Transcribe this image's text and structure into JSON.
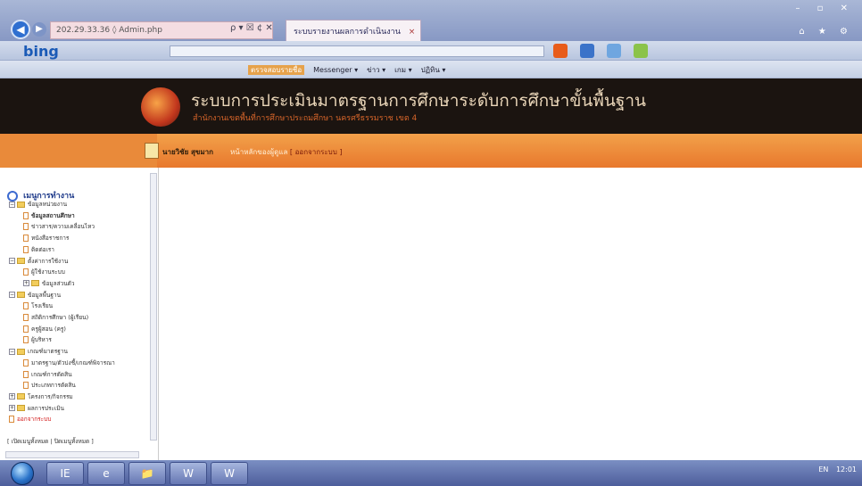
{
  "browser": {
    "address_text": "202.29.33.36 ◊ Admin.php",
    "address_controls": "ρ ▾ ☒ ¢ ✕",
    "tab_title": "ระบบรายงานผลการดำเนินงาน",
    "tab_close": "×",
    "window_controls": "– ▫ ✕",
    "window_controls_2": "⌂ ★ ⚙"
  },
  "bing_bar": {
    "logo": "bing",
    "icon_colors": [
      "#e85c1a",
      "#3b73c9",
      "#6fa6e0",
      "#8bc34a"
    ]
  },
  "favorites_bar": {
    "items": [
      "ตรวจสอบรายชื่อ",
      "Messenger ▾",
      "ข่าว ▾",
      "เกม ▾",
      "ปฏิทิน ▾"
    ]
  },
  "site": {
    "title": "ระบบการประเมินมาตรฐานการศึกษาระดับการศึกษาขั้นพื้นฐาน",
    "subtitle": "สำนักงานเขตพื้นที่การศึกษาประถมศึกษา นครศรีธรรมราช เขต 4"
  },
  "user_bar": {
    "user_name": "นายวิชัย สุขมาก",
    "status_text": "หน้าหลักของผู้ดูแล",
    "logout_label": "[ ออกจากระบบ ]"
  },
  "left_menu": {
    "title": "เมนูการทำงาน",
    "items": [
      {
        "type": "folder",
        "level": 0,
        "label": "ข้อมูลหน่วยงาน",
        "toggle": "−"
      },
      {
        "type": "doc",
        "level": 1,
        "label": "ข้อมูลสถานศึกษา",
        "bold": true
      },
      {
        "type": "doc",
        "level": 1,
        "label": "ข่าวสาร/ความเคลื่อนไหว"
      },
      {
        "type": "doc",
        "level": 1,
        "label": "หนังสือราชการ"
      },
      {
        "type": "doc",
        "level": 1,
        "label": "ติดต่อเรา"
      },
      {
        "type": "folder",
        "level": 0,
        "label": "ตั้งค่าการใช้งาน",
        "toggle": "−"
      },
      {
        "type": "doc",
        "level": 1,
        "label": "ผู้ใช้งานระบบ"
      },
      {
        "type": "folder",
        "level": 1,
        "label": "ข้อมูลส่วนตัว",
        "toggle": "+"
      },
      {
        "type": "folder",
        "level": 0,
        "label": "ข้อมูลพื้นฐาน",
        "toggle": "−"
      },
      {
        "type": "doc",
        "level": 1,
        "label": "โรงเรียน"
      },
      {
        "type": "doc",
        "level": 1,
        "label": "สถิติการศึกษา (ผู้เรียน)"
      },
      {
        "type": "doc",
        "level": 1,
        "label": "ครูผู้สอน (ครู)"
      },
      {
        "type": "doc",
        "level": 1,
        "label": "ผู้บริหาร"
      },
      {
        "type": "folder",
        "level": 0,
        "label": "เกณฑ์มาตรฐาน",
        "toggle": "−"
      },
      {
        "type": "doc",
        "level": 1,
        "label": "มาตรฐาน/ตัวบ่งชี้/เกณฑ์พิจารณา"
      },
      {
        "type": "doc",
        "level": 1,
        "label": "เกณฑ์การตัดสิน"
      },
      {
        "type": "doc",
        "level": 1,
        "label": "ประเภทการตัดสิน"
      },
      {
        "type": "folder",
        "level": 0,
        "label": "โครงการ/กิจกรรม",
        "toggle": "+"
      },
      {
        "type": "folder",
        "level": 0,
        "label": "ผลการประเมิน",
        "toggle": "+"
      },
      {
        "type": "doc",
        "level": 0,
        "label": "ออกจากระบบ",
        "red": true
      }
    ],
    "bottom_links": "[ เปิดเมนูทั้งหมด | ปิดเมนูทั้งหมด ]"
  },
  "taskbar": {
    "apps": [
      "IE",
      "e",
      "📁",
      "W",
      "W"
    ],
    "tray_lang": "EN",
    "tray_time": "12:01"
  }
}
